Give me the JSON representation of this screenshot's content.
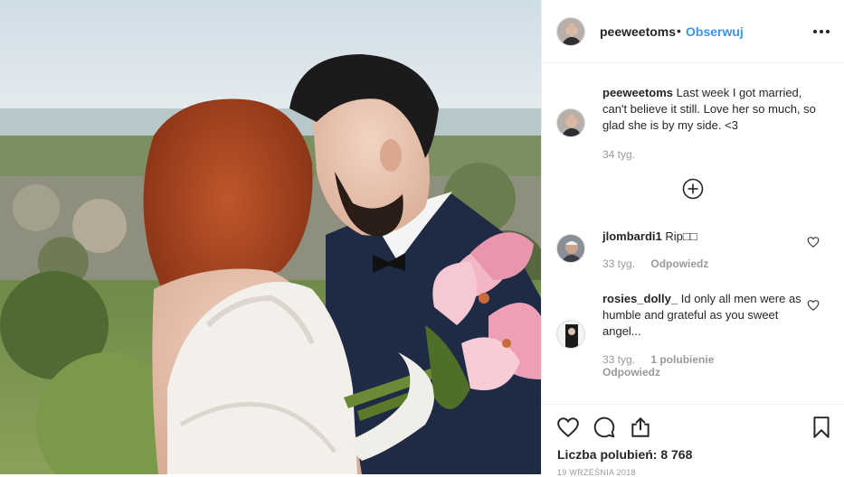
{
  "post": {
    "username": "peeweetoms",
    "separator": "•",
    "follow_label": "Obserwuj",
    "more_icon": "more-options-icon"
  },
  "caption": {
    "username": "peeweetoms",
    "text": "Last week I got married, can't believe it still. Love her so much, so glad she is by my side. <3",
    "time": "34 tyg."
  },
  "load_more_icon": "plus-circle-icon",
  "comments": [
    {
      "username": "jlombardi1",
      "text": "Rip□□",
      "time": "33 tyg.",
      "reply_label": "Odpowiedz"
    },
    {
      "username": "rosies_dolly_",
      "text": "Id only all men were as humble and grateful as you sweet angel...",
      "time": "33 tyg.",
      "likes_label": "1 polubienie",
      "reply_label": "Odpowiedz"
    }
  ],
  "actions": {
    "icons": [
      "heart-icon",
      "comment-icon",
      "share-icon",
      "bookmark-icon"
    ],
    "likes_label": "Liczba polubień: 8 768",
    "date": "19 września 2018"
  },
  "colors": {
    "link": "#3897f0",
    "text": "#262626",
    "muted": "#999999",
    "border": "#efefef"
  }
}
